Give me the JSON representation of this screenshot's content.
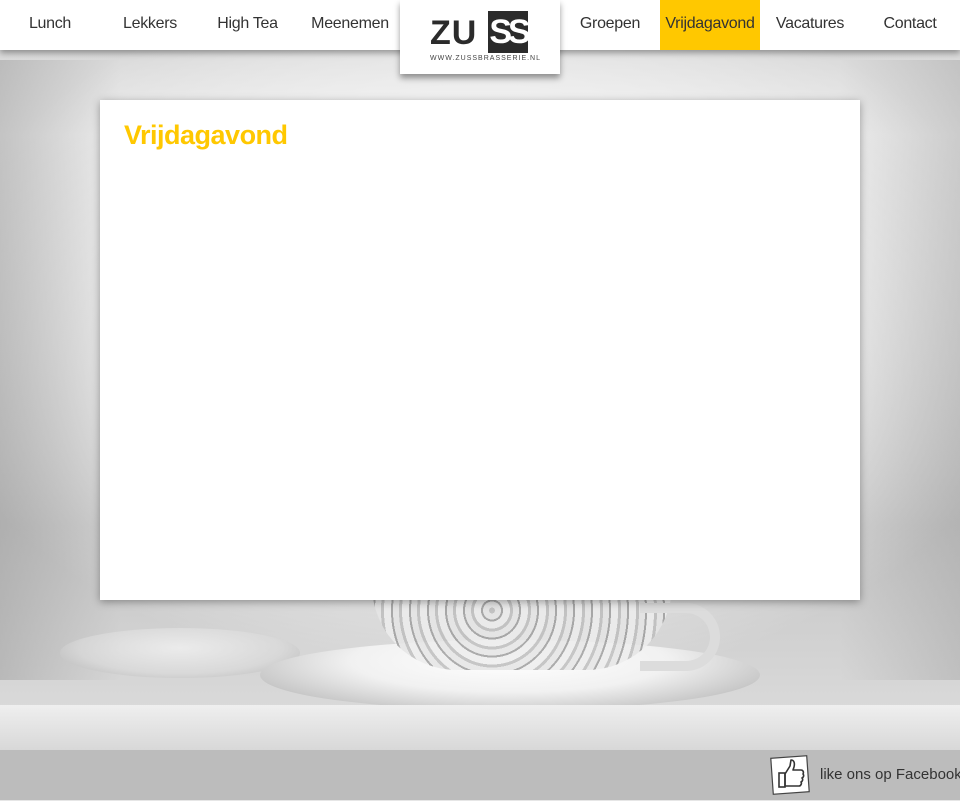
{
  "nav": {
    "left_items": [
      {
        "label": "Lunch"
      },
      {
        "label": "Lekkers"
      },
      {
        "label": "High Tea"
      },
      {
        "label": "Meenemen"
      }
    ],
    "right_items": [
      {
        "label": "Groepen"
      },
      {
        "label": "Vrijdagavond",
        "active": true
      },
      {
        "label": "Vacatures"
      },
      {
        "label": "Contact"
      }
    ]
  },
  "logo": {
    "text_left": "ZU",
    "text_right": "SS",
    "url": "WWW.ZUSSBRASSERIE.NL"
  },
  "main": {
    "title": "Vrijdagavond"
  },
  "footer": {
    "facebook_label": "like ons op Facebook",
    "icon": "thumbs-up-icon"
  },
  "colors": {
    "accent": "#ffc800",
    "footer_bg": "#bcbcbc",
    "nav_bg": "#ffffff",
    "text": "#333333"
  }
}
